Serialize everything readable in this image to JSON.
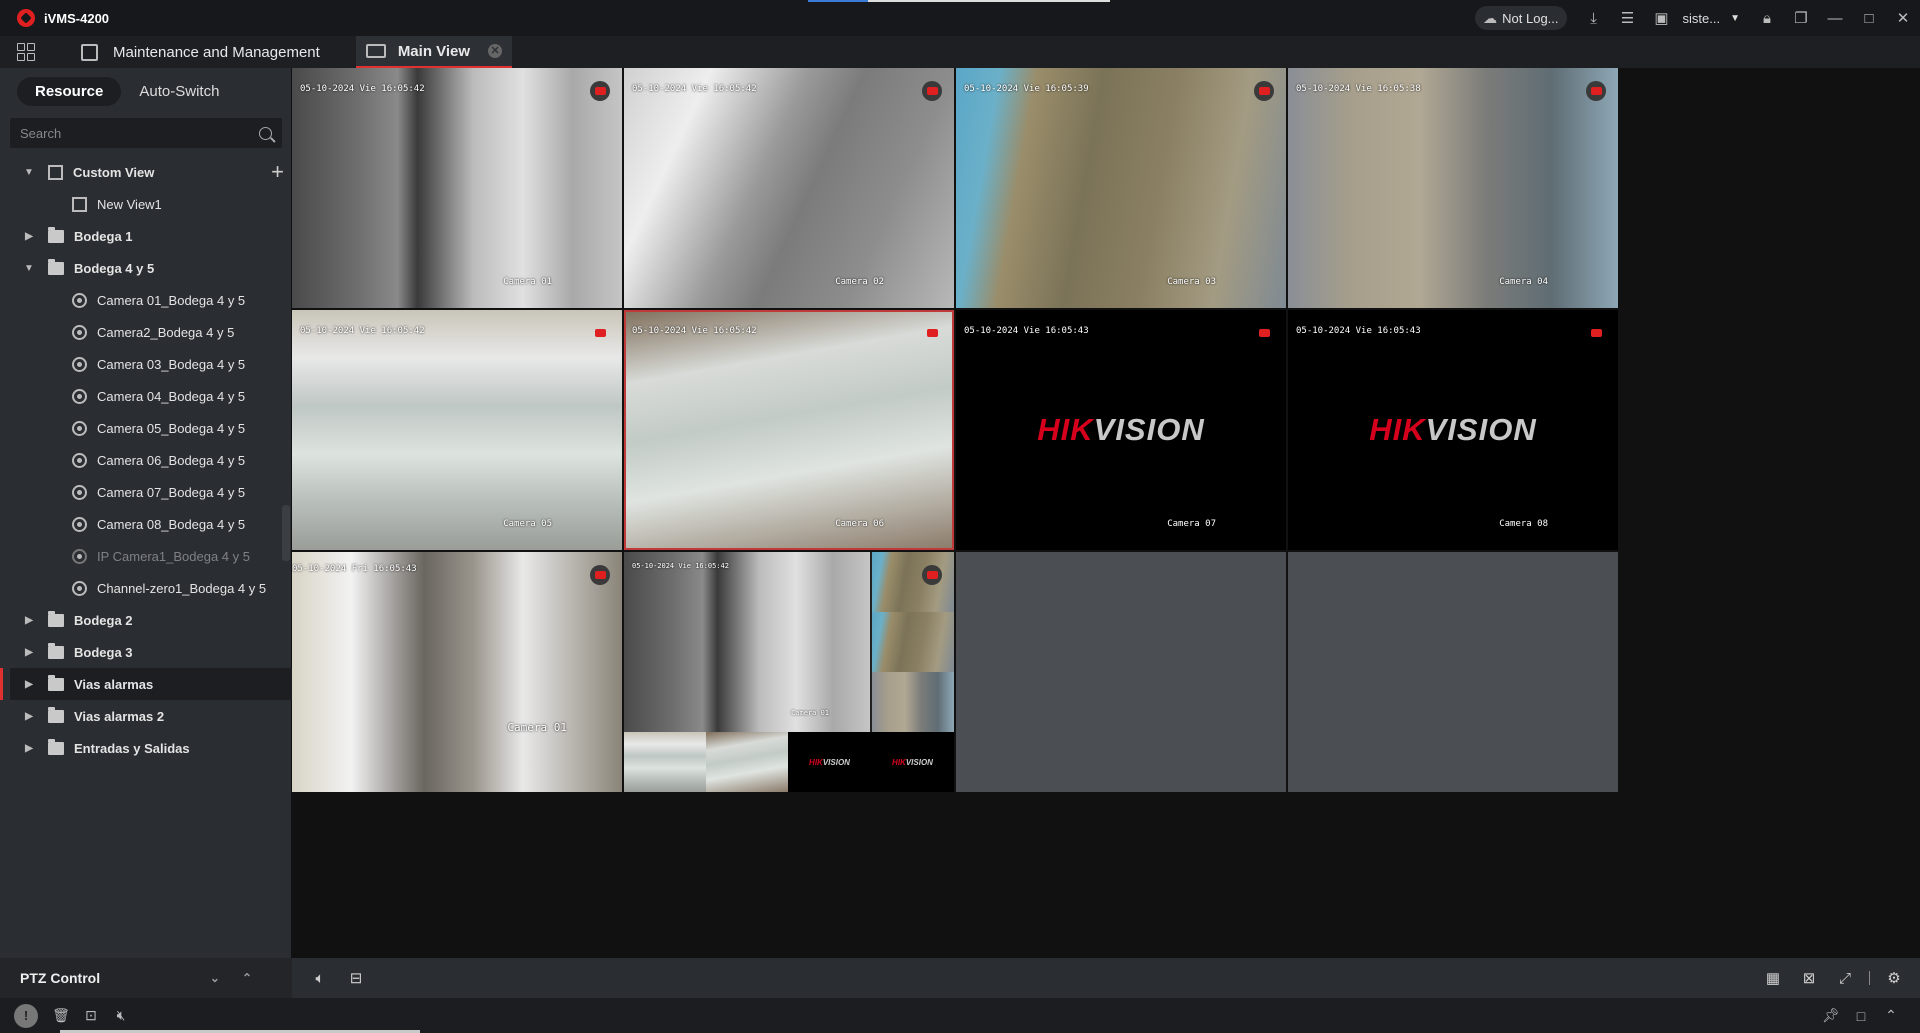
{
  "app": {
    "title": "iVMS-4200",
    "not_logged": "Not Log...",
    "user": "siste..."
  },
  "tabs": {
    "maintenance": "Maintenance and Management",
    "main_view": "Main View"
  },
  "sidebar": {
    "mode_tabs": {
      "resource": "Resource",
      "auto_switch": "Auto-Switch"
    },
    "search_placeholder": "Search",
    "tree": {
      "custom_view": "Custom View",
      "new_view": "New View1",
      "bodega1": "Bodega 1",
      "bodega45": "Bodega 4 y 5",
      "cameras": [
        "Camera 01_Bodega 4 y 5",
        "Camera2_Bodega 4 y 5",
        "Camera 03_Bodega 4 y 5",
        "Camera 04_Bodega 4 y 5",
        "Camera 05_Bodega 4 y 5",
        "Camera 06_Bodega 4 y 5",
        "Camera 07_Bodega 4 y 5",
        "Camera 08_Bodega 4 y 5",
        "IP Camera1_Bodega 4 y 5",
        "Channel-zero1_Bodega 4 y 5"
      ],
      "bodega2": "Bodega 2",
      "bodega3": "Bodega 3",
      "vias_alarmas": "Vias alarmas",
      "vias_alarmas2": "Vias alarmas 2",
      "entradas": "Entradas y Salidas"
    },
    "ptz": "PTZ Control"
  },
  "cells": [
    {
      "ts": "05-10-2024 Vie  16:05:42",
      "cam": "Camera 01"
    },
    {
      "ts": "05-10-2024 Vie  16:05:42",
      "cam": "Camera 02"
    },
    {
      "ts": "05-10-2024 Vie  16:05:39",
      "cam": "Camera 03"
    },
    {
      "ts": "05-10-2024 Vie  16:05:38",
      "cam": "Camera 04"
    },
    {
      "ts": "05-10-2024 Vie  16:05:42",
      "cam": "Camera 05"
    },
    {
      "ts": "05-10-2024 Vie  16:05:42",
      "cam": "Camera 06"
    },
    {
      "ts": "05-10-2024 Vie  16:05:43",
      "cam": "Camera 07"
    },
    {
      "ts": "05-10-2024 Vie  16:05:43",
      "cam": "Camera 08"
    },
    {
      "ts": "05-10-2024 Fri 16:05:43",
      "cam": "Camera 01"
    },
    {
      "ts": "05-10-2024 Vie  16:05:42",
      "cam": "Camera 01"
    }
  ],
  "hik": {
    "r": "HIK",
    "w": "VISION"
  }
}
